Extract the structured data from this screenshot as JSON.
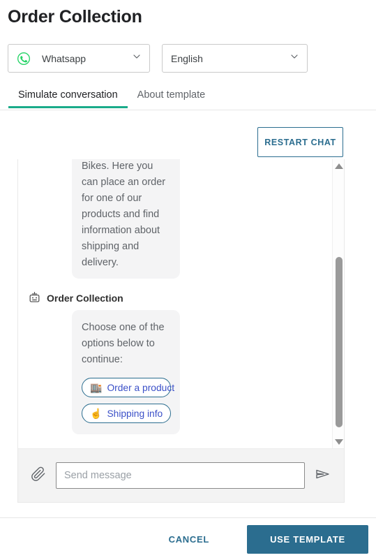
{
  "header": {
    "title": "Order Collection"
  },
  "selects": {
    "channel": {
      "value": "Whatsapp",
      "icon": "whatsapp-icon"
    },
    "language": {
      "value": "English"
    }
  },
  "tabs": [
    {
      "label": "Simulate conversation",
      "active": true
    },
    {
      "label": "About template",
      "active": false
    }
  ],
  "actions": {
    "restart_chat": "RESTART CHAT"
  },
  "chat": {
    "messages": [
      {
        "type": "bot-bubble-continued",
        "text": "Bikes. Here you can place an order for one of our products and find information about shipping and delivery."
      },
      {
        "type": "bot-bubble",
        "sender": "Order Collection",
        "sender_icon": "robot-icon",
        "text": "Choose one of the options below to continue:",
        "options": [
          {
            "emoji": "🏬",
            "label": "Order a product"
          },
          {
            "emoji": "☝️",
            "label": "Shipping info"
          }
        ]
      }
    ],
    "scrollbar": {
      "up_arrow": "scroll-up",
      "down_arrow": "scroll-down"
    }
  },
  "composer": {
    "attach_icon": "paperclip-icon",
    "placeholder": "Send message",
    "value": "",
    "send_icon": "send-icon"
  },
  "footer": {
    "cancel": "CANCEL",
    "use_template": "USE TEMPLATE"
  },
  "colors": {
    "accent_teal": "#2b6d8f",
    "tab_underline": "#1aab8a",
    "whatsapp_green": "#25d366",
    "option_text": "#3b50c8"
  }
}
